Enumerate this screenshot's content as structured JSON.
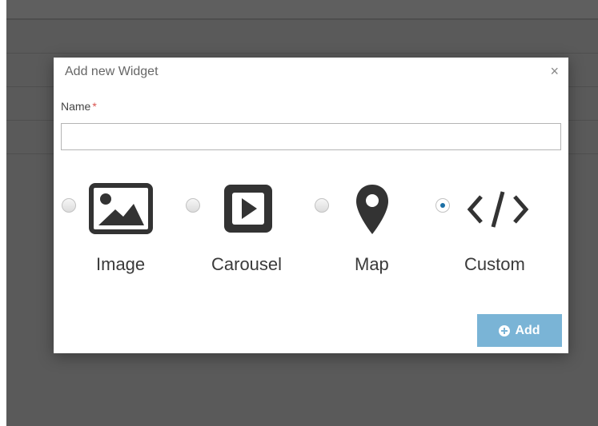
{
  "modal": {
    "title": "Add new Widget",
    "close_label": "×",
    "name_label": "Name",
    "required_mark": "*",
    "name_value": "",
    "name_placeholder": "",
    "options": [
      {
        "label": "Image",
        "icon": "image-icon",
        "selected": false
      },
      {
        "label": "Carousel",
        "icon": "play-icon",
        "selected": false
      },
      {
        "label": "Map",
        "icon": "map-marker-icon",
        "selected": false
      },
      {
        "label": "Custom",
        "icon": "code-icon",
        "selected": true
      }
    ],
    "add_label": "Add"
  },
  "colors": {
    "backdrop": "#5a5a5a",
    "button": "#7ab4d6",
    "required": "#d9534f",
    "icon": "#333333"
  }
}
